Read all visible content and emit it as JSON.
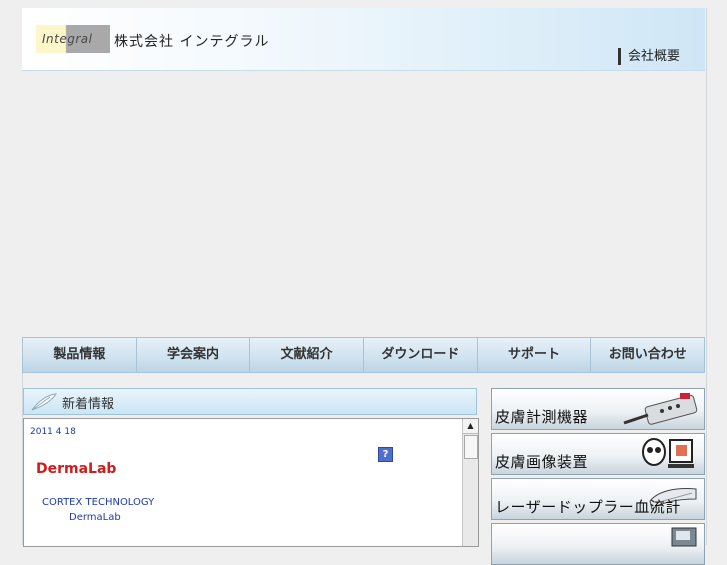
{
  "header": {
    "logo_text": "Integral",
    "company_name": "株式会社 インテグラル",
    "corporate_link": "会社概要"
  },
  "nav": {
    "tabs": [
      "製品情報",
      "学会案内",
      "文献紹介",
      "ダウンロード",
      "サポート",
      "お問い合わせ"
    ]
  },
  "news": {
    "title": "新着情報",
    "date": "2011 4 18",
    "product": "DermaLab",
    "maker": "CORTEX TECHNOLOGY",
    "product_sub": "DermaLab",
    "help_glyph": "?"
  },
  "side": {
    "items": [
      {
        "label": "皮膚計測機器",
        "icon": "probe-device-icon"
      },
      {
        "label": "皮膚画像装置",
        "icon": "imaging-device-icon"
      },
      {
        "label": "レーザードップラー血流計",
        "icon": "laser-doppler-icon"
      },
      {
        "label": "",
        "icon": "equipment-icon"
      }
    ]
  },
  "colors": {
    "news_product": "#d41b1b",
    "link_blue": "#1b3bb5",
    "nav_bg": "#cfe2ef"
  }
}
